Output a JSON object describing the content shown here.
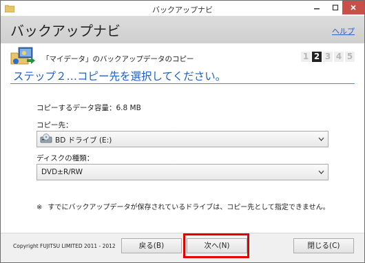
{
  "window": {
    "title": "バックアップナビ",
    "controls": [
      "minimize",
      "maximize",
      "close"
    ]
  },
  "header": {
    "app_title": "バックアップナビ",
    "help_link": "ヘルプ"
  },
  "step": {
    "subtitle": "「マイデータ」のバックアップデータのコピー",
    "numbers": [
      "1",
      "2",
      "3",
      "4",
      "5"
    ],
    "current": "2",
    "title": "ステップ２…コピー先を選択してください。"
  },
  "form": {
    "capacity_label": "コピーするデータ容量：6.8 MB",
    "destination_label": "コピー先：",
    "destination_value": "BD ドライブ (E:)",
    "disc_type_label": "ディスクの種類：",
    "disc_type_value": "DVD±R/RW"
  },
  "note": {
    "mark": "※",
    "text": "すでにバックアップデータが保存されているドライブは、コピー先として指定できません。"
  },
  "footer": {
    "copyright": "Copyright FUJITSU LIMITED 2011 - 2012",
    "back_button": "戻る(B)",
    "next_button": "次へ(N)",
    "close_button": "閉じる(C)"
  },
  "colors": {
    "accent": "#1f5fc8",
    "highlight": "#e00000",
    "close_button": "#c7504a"
  }
}
